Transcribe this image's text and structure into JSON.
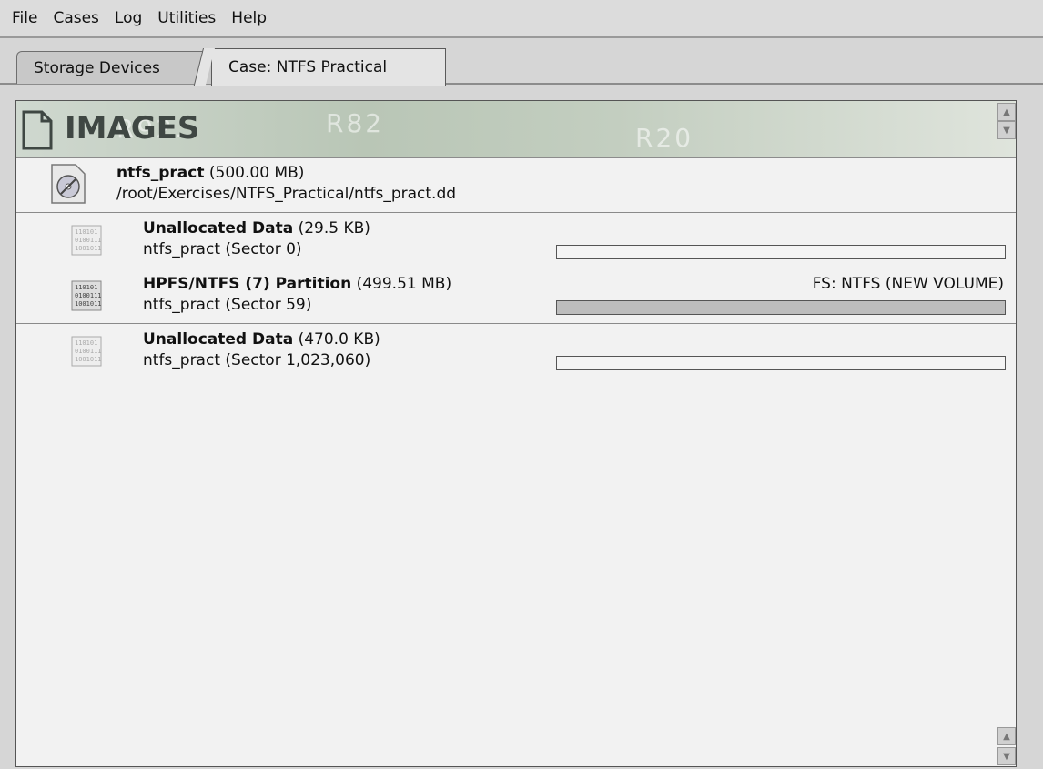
{
  "menu": [
    "File",
    "Cases",
    "Log",
    "Utilities",
    "Help"
  ],
  "tabs": [
    {
      "label": "Storage Devices",
      "active": false
    },
    {
      "label": "Case: NTFS Practical",
      "active": true
    }
  ],
  "panel": {
    "title": "IMAGES",
    "image": {
      "name": "ntfs_pract",
      "size": "(500.00 MB)",
      "path": "/root/Exercises/NTFS_Practical/ntfs_pract.dd"
    },
    "rows": [
      {
        "title": "Unallocated Data",
        "size": "(29.5 KB)",
        "sub": "ntfs_pract (Sector 0)",
        "fs": "",
        "fill": 0.0,
        "icon": "binary-data-icon"
      },
      {
        "title": "HPFS/NTFS (7) Partition",
        "size": "(499.51 MB)",
        "sub": "ntfs_pract (Sector 59)",
        "fs": "FS: NTFS (NEW VOLUME)",
        "fill": 1.0,
        "icon": "binary-data-icon"
      },
      {
        "title": "Unallocated Data",
        "size": "(470.0 KB)",
        "sub": "ntfs_pract (Sector 1,023,060)",
        "fs": "",
        "fill": 0.0,
        "icon": "binary-data-icon"
      }
    ]
  },
  "colors": {
    "bar_fill": "#bdbdbd",
    "header_bg": "#c3cec0"
  }
}
